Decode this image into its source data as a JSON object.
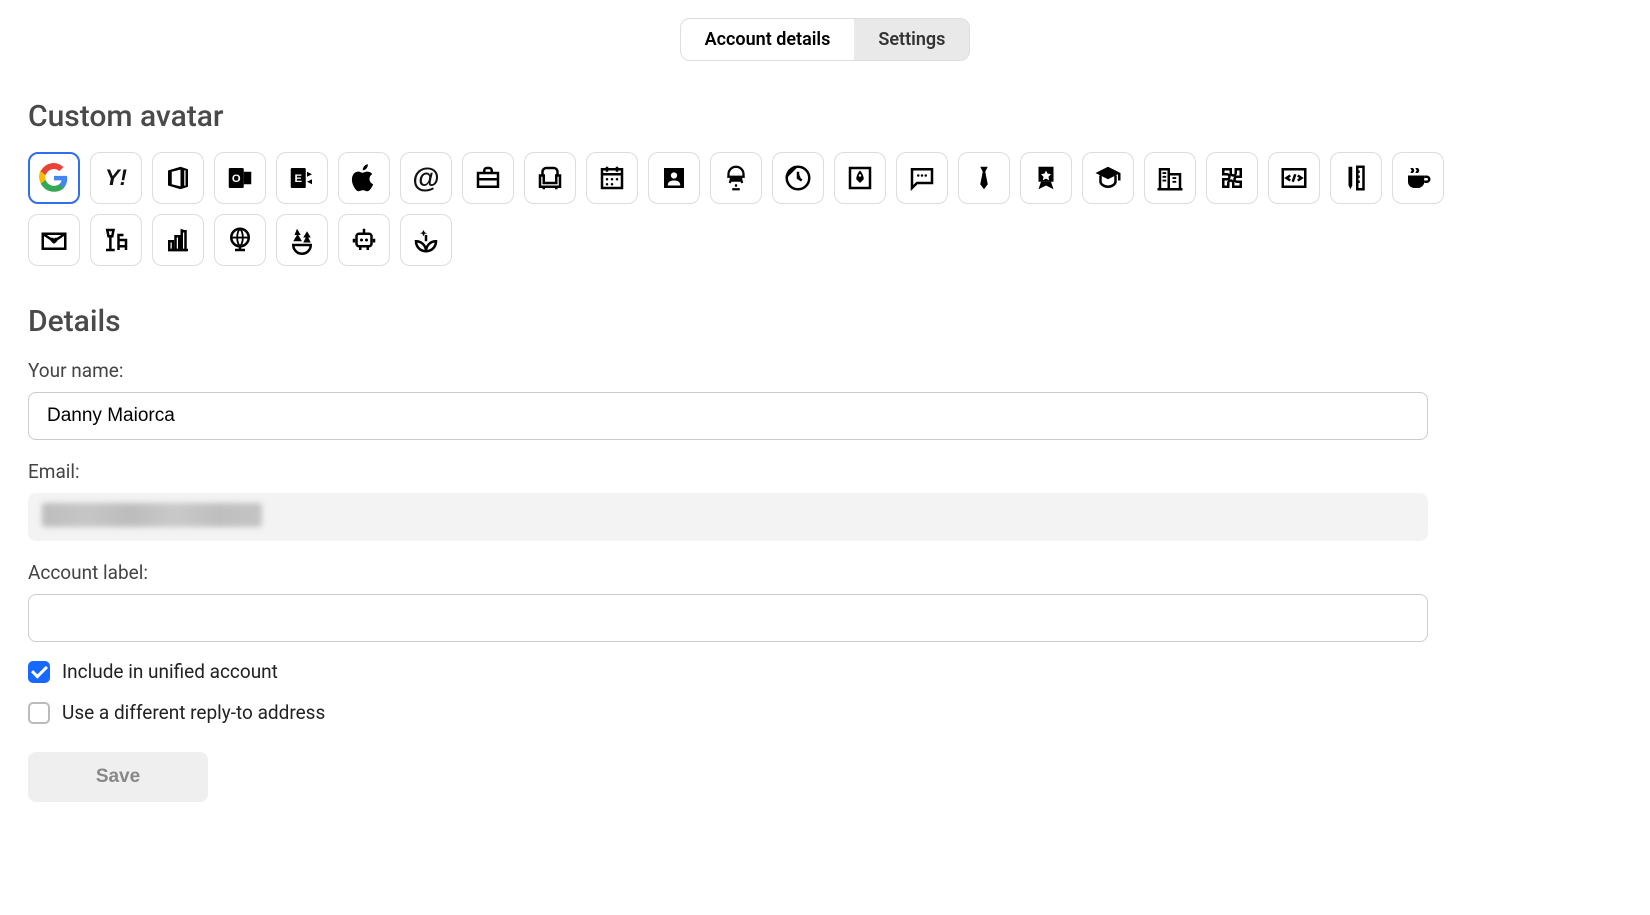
{
  "tabs": {
    "account_details": "Account details",
    "settings": "Settings"
  },
  "sections": {
    "custom_avatar": "Custom avatar",
    "details": "Details"
  },
  "avatars": [
    {
      "id": "google",
      "selected": true
    },
    {
      "id": "yahoo"
    },
    {
      "id": "office"
    },
    {
      "id": "outlook"
    },
    {
      "id": "exchange"
    },
    {
      "id": "apple"
    },
    {
      "id": "at-sign"
    },
    {
      "id": "briefcase"
    },
    {
      "id": "armchair"
    },
    {
      "id": "calendar"
    },
    {
      "id": "photo-frame"
    },
    {
      "id": "hacker"
    },
    {
      "id": "clock"
    },
    {
      "id": "rocket-window"
    },
    {
      "id": "chat"
    },
    {
      "id": "tie"
    },
    {
      "id": "ribbon"
    },
    {
      "id": "graduation"
    },
    {
      "id": "buildings"
    },
    {
      "id": "puzzle"
    },
    {
      "id": "code"
    },
    {
      "id": "pencil-ruler"
    },
    {
      "id": "coffee"
    },
    {
      "id": "love-letter"
    },
    {
      "id": "lamp-chair"
    },
    {
      "id": "bar-chart"
    },
    {
      "id": "globe"
    },
    {
      "id": "trees-bowl"
    },
    {
      "id": "robot"
    },
    {
      "id": "sparkle-leaf"
    }
  ],
  "form": {
    "name_label": "Your name:",
    "name_value": "Danny Maiorca",
    "email_label": "Email:",
    "email_value_redacted": true,
    "account_label_label": "Account label:",
    "account_label_value": "",
    "include_unified_label": "Include in unified account",
    "include_unified_checked": true,
    "reply_to_label": "Use a different reply-to address",
    "reply_to_checked": false,
    "save_label": "Save"
  }
}
